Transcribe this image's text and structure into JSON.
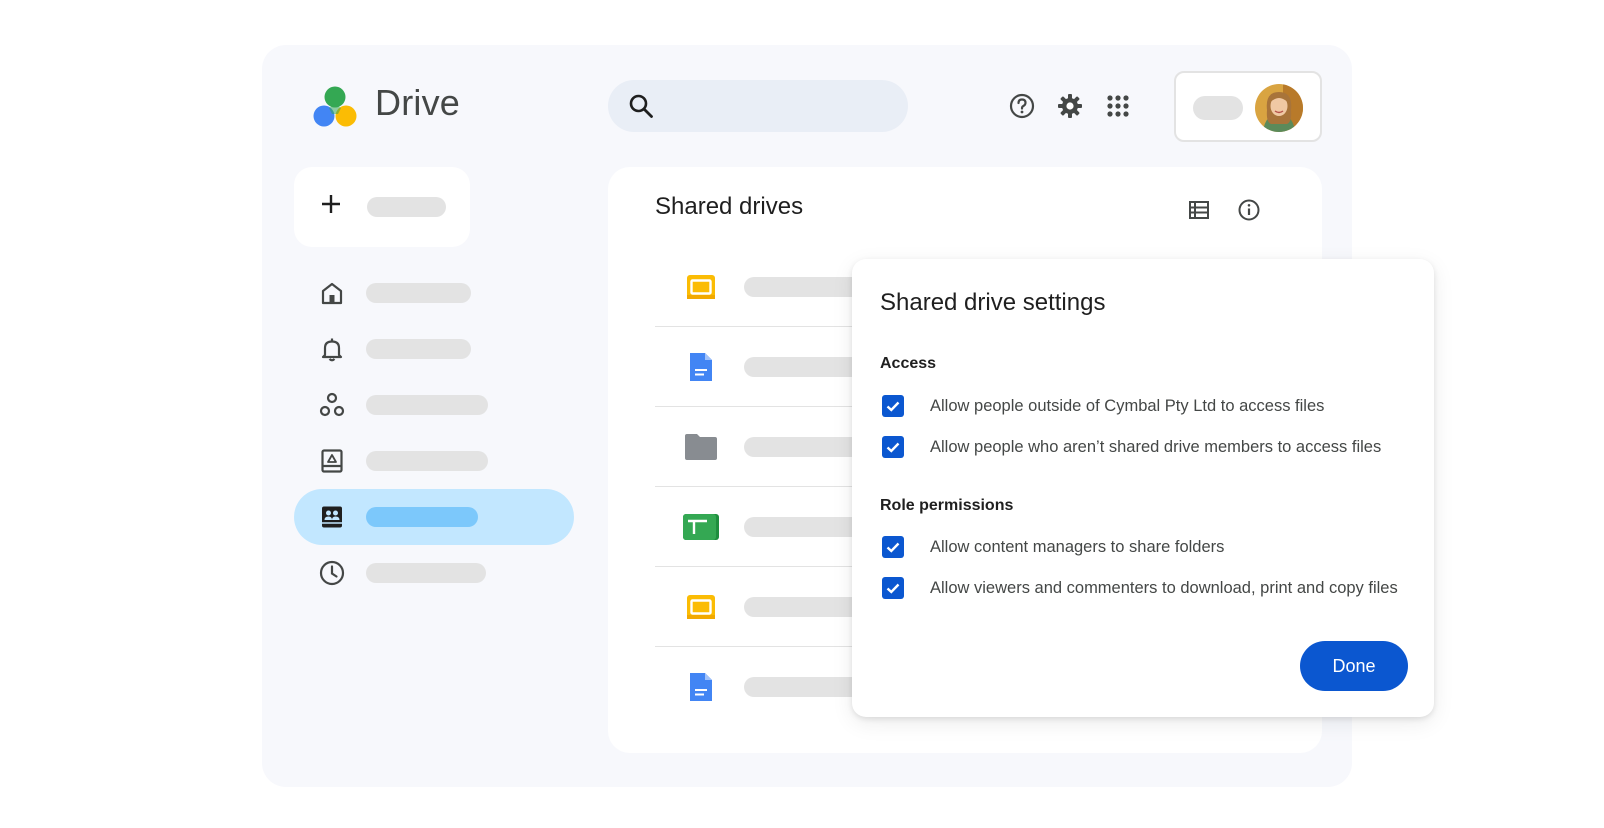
{
  "app": {
    "title": "Drive",
    "brand_colors": [
      "#34a853",
      "#fbbc04",
      "#4285f4",
      "#ea4335"
    ]
  },
  "header": {
    "search_icon": "search-icon",
    "icons": [
      "help-icon",
      "settings-icon",
      "apps-grid-icon"
    ],
    "account_avatar": "avatar"
  },
  "sidebar": {
    "new_button_icon": "plus-icon",
    "items": [
      {
        "icon": "home-icon",
        "active": false
      },
      {
        "icon": "bell-icon",
        "active": false
      },
      {
        "icon": "workspaces-icon",
        "active": false
      },
      {
        "icon": "my-drive-icon",
        "active": false
      },
      {
        "icon": "shared-drives-icon",
        "active": true
      },
      {
        "icon": "clock-icon",
        "active": false
      }
    ]
  },
  "main": {
    "title": "Shared drives",
    "tools": [
      "list-view-icon",
      "info-icon"
    ],
    "rows": [
      {
        "icon": "slides-icon"
      },
      {
        "icon": "docs-icon"
      },
      {
        "icon": "folder-icon"
      },
      {
        "icon": "sheets-icon"
      },
      {
        "icon": "slides-icon"
      },
      {
        "icon": "docs-icon"
      }
    ]
  },
  "dialog": {
    "title": "Shared drive settings",
    "sections": [
      {
        "title": "Access",
        "options": [
          {
            "label": "Allow people outside of Cymbal Pty Ltd to access files",
            "checked": true
          },
          {
            "label": "Allow people who aren’t shared drive members to access files",
            "checked": true
          }
        ]
      },
      {
        "title": "Role permissions",
        "options": [
          {
            "label": "Allow content managers to share folders",
            "checked": true
          },
          {
            "label": "Allow viewers and commenters to download, print and copy files",
            "checked": true
          }
        ]
      }
    ],
    "done_label": "Done",
    "accent_color": "#0b57d0"
  }
}
